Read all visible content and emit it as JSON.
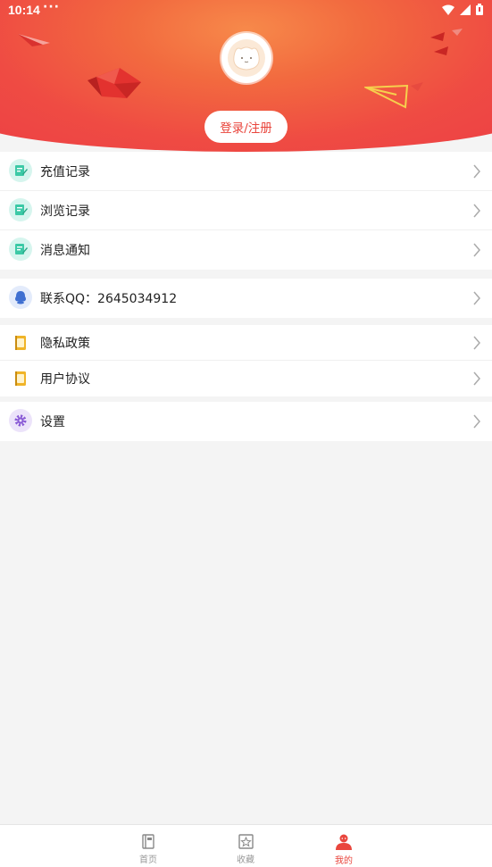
{
  "statusbar": {
    "time": "10:14",
    "dots": "···"
  },
  "header": {
    "login_label": "登录/注册"
  },
  "groups": [
    {
      "items": [
        {
          "label": "充值记录",
          "icon": "recharge-record-icon"
        },
        {
          "label": "浏览记录",
          "icon": "browse-record-icon"
        },
        {
          "label": "消息通知",
          "icon": "message-notice-icon"
        }
      ]
    },
    {
      "items": [
        {
          "label": "联系QQ：2645034912",
          "icon": "qq-icon"
        }
      ]
    },
    {
      "items": [
        {
          "label": "隐私政策",
          "icon": "privacy-book-icon"
        },
        {
          "label": "用户协议",
          "icon": "agreement-book-icon"
        }
      ]
    },
    {
      "items": [
        {
          "label": "设置",
          "icon": "settings-gear-icon"
        }
      ]
    }
  ],
  "bottomnav": {
    "items": [
      {
        "label": "首页",
        "icon": "home-book-icon",
        "active": false
      },
      {
        "label": "收藏",
        "icon": "favorite-star-icon",
        "active": false
      },
      {
        "label": "我的",
        "icon": "profile-user-icon",
        "active": true
      }
    ]
  },
  "colors": {
    "accent": "#e9463d",
    "green_icon_bg": "#d6f5ee",
    "green_icon": "#3cc9a6",
    "qq_blue": "#3f6fd1",
    "book_yellow": "#f0b428",
    "purple": "#8a5bd6"
  }
}
